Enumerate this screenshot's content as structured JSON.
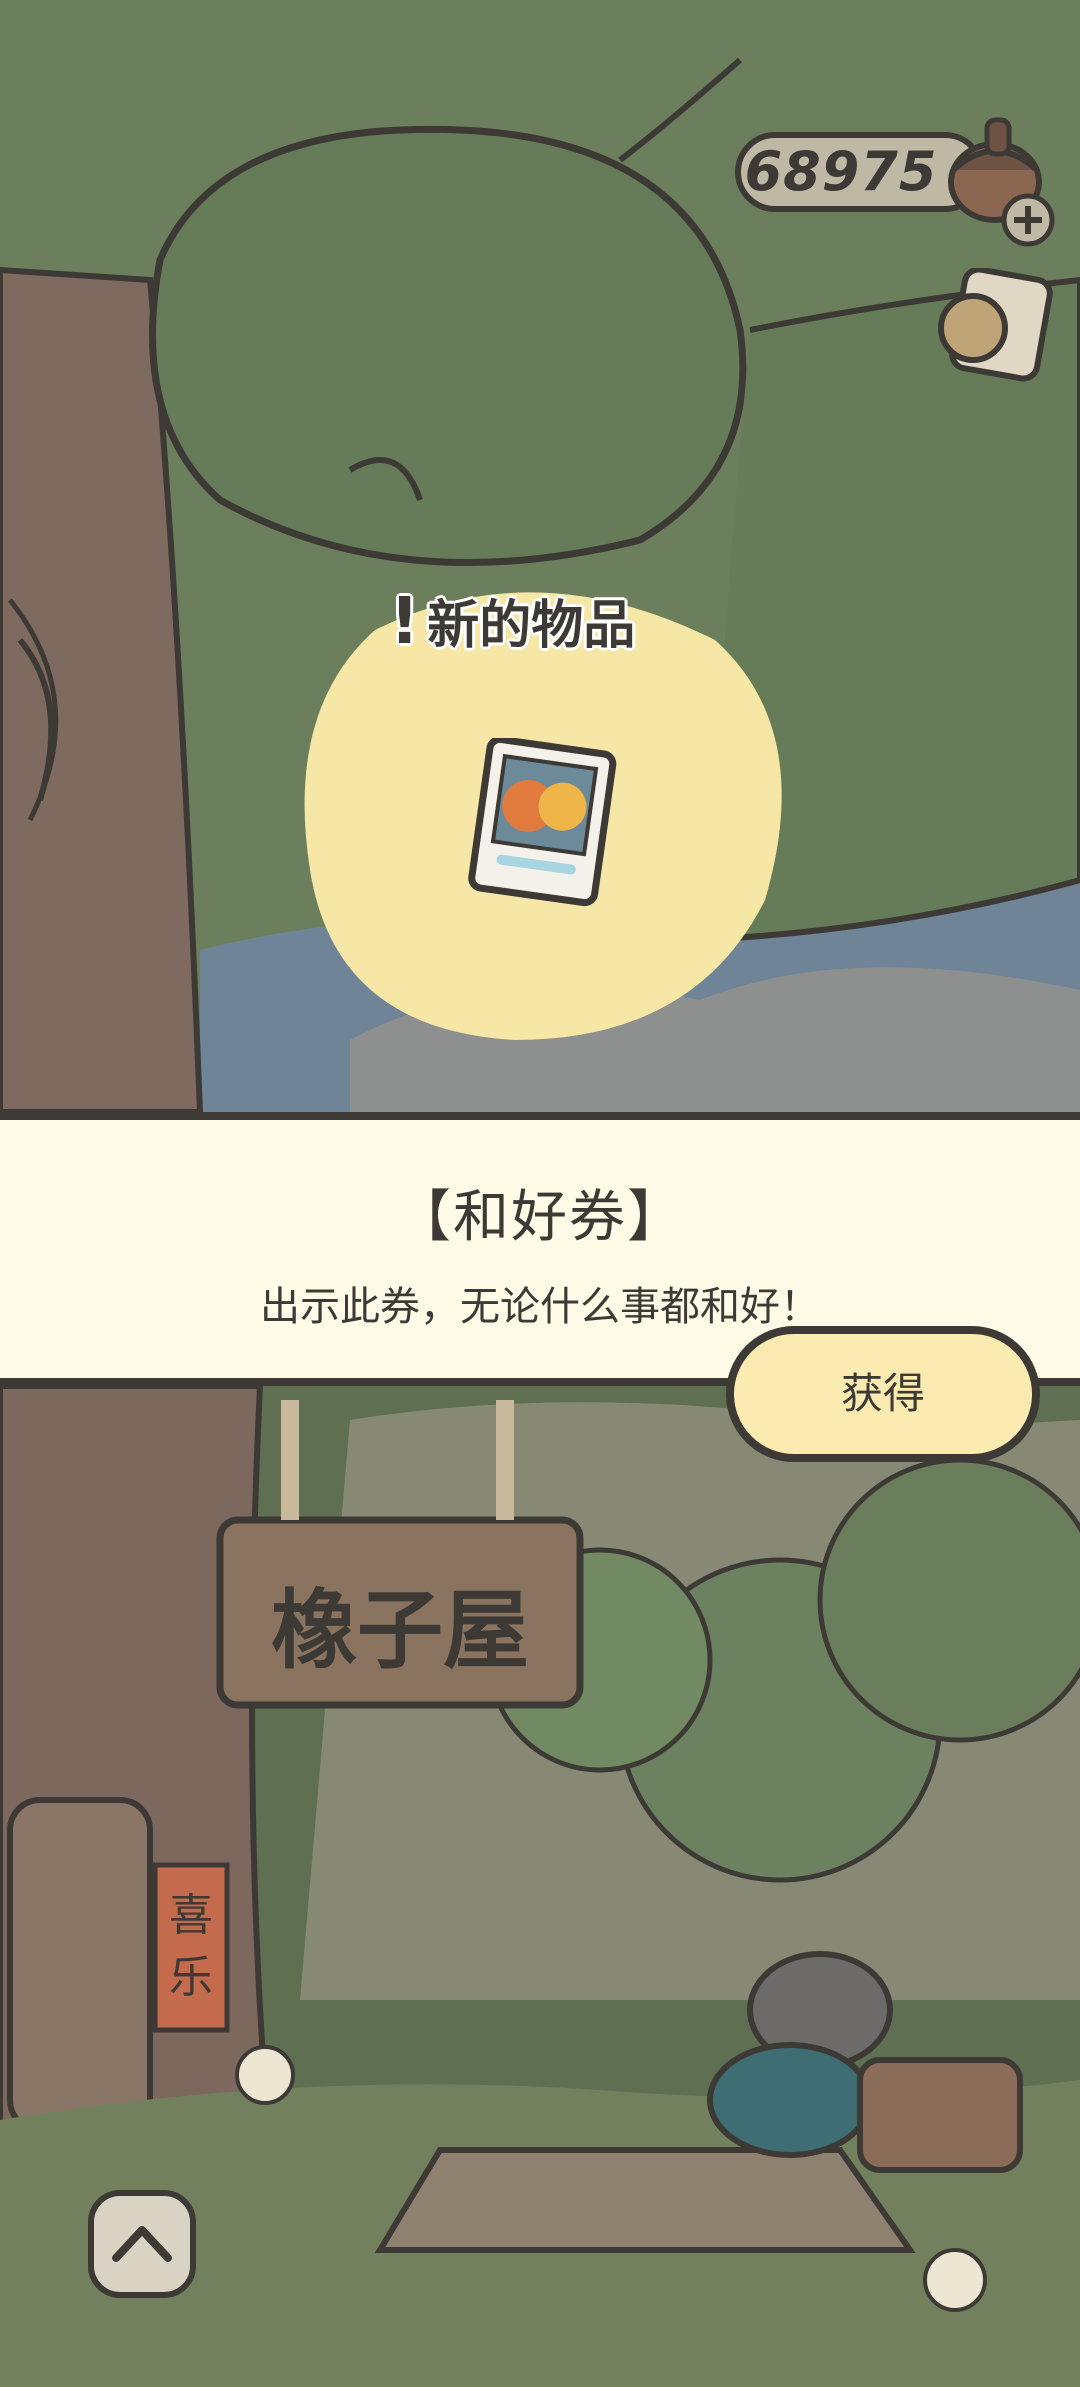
{
  "currency": {
    "value": "68975",
    "icon": "acorn-icon",
    "add_icon": "plus-icon"
  },
  "popup": {
    "new_item_label": "新的物品",
    "item_icon": "ticket-icon"
  },
  "item": {
    "name": "【和好券】",
    "description": "出示此券，无论什么事都和好！"
  },
  "buttons": {
    "obtain_label": "获得",
    "scroll_up_icon": "chevron-up-icon"
  },
  "scene": {
    "sign_text": "橡子屋",
    "banner_text": "喜乐"
  },
  "colors": {
    "outline": "#3d3a36",
    "band_background": "#fffbe6",
    "button_fill": "#fcebb0",
    "foliage": "#6b7f5c"
  }
}
